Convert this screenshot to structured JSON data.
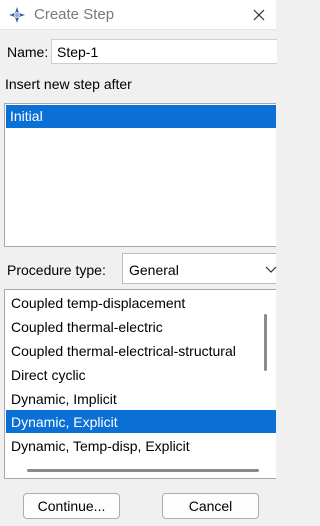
{
  "window": {
    "title": "Create Step",
    "icon": "abaqus-app-icon",
    "close_icon": "close-icon"
  },
  "name_field": {
    "label": "Name:",
    "value": "Step-1"
  },
  "insert_after": {
    "label": "Insert new step after",
    "items": [
      "Initial"
    ],
    "selected_index": 0
  },
  "procedure": {
    "label": "Procedure type:",
    "selected": "General",
    "items": [
      "Coupled temp-displacement",
      "Coupled thermal-electric",
      "Coupled thermal-electrical-structural",
      "Direct cyclic",
      "Dynamic, Implicit",
      "Dynamic, Explicit",
      "Dynamic, Temp-disp, Explicit"
    ],
    "selected_index": 5
  },
  "buttons": {
    "continue": "Continue...",
    "cancel": "Cancel"
  },
  "colors": {
    "selection": "#0a70d6",
    "background": "#f0f0f0"
  }
}
